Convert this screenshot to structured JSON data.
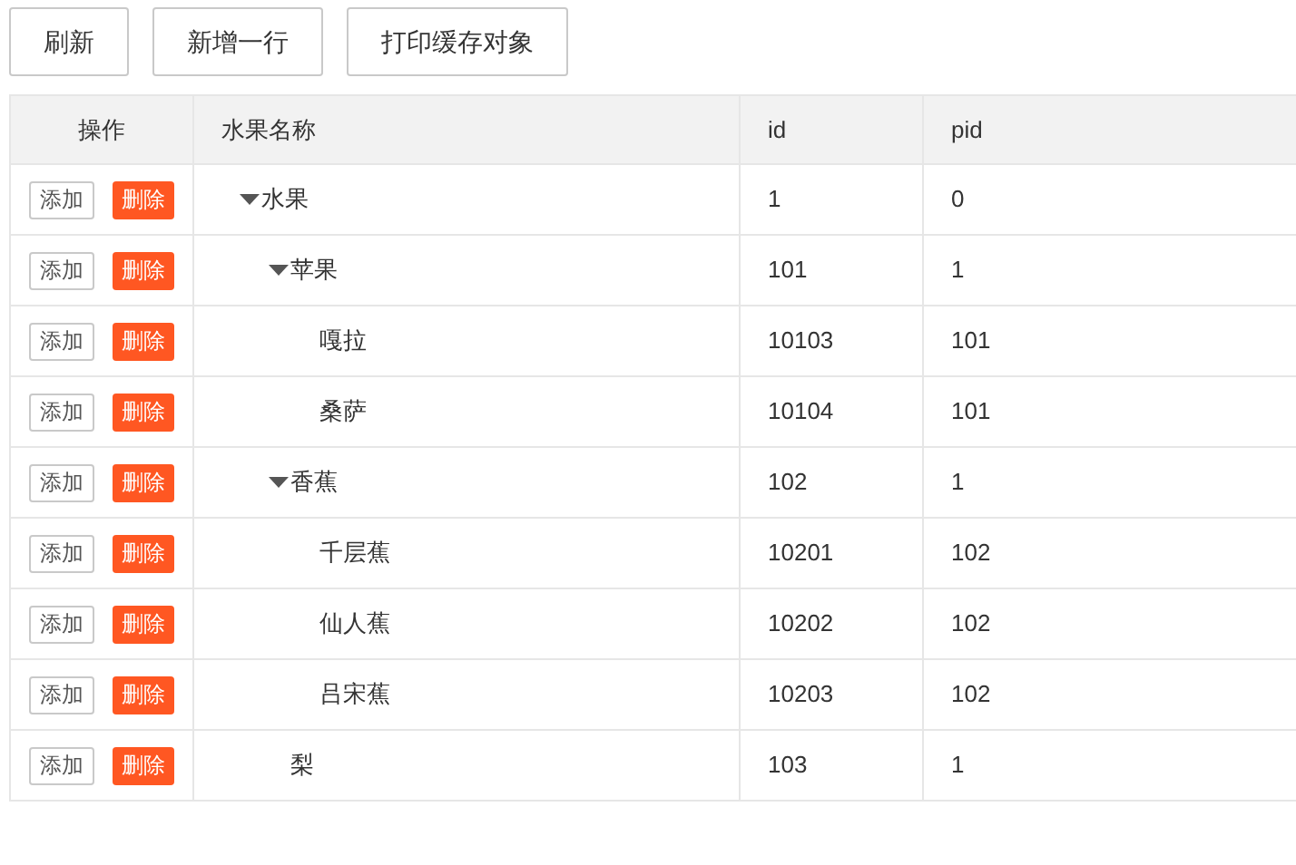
{
  "toolbar": [
    "刷新",
    "新增一行",
    "打印缓存对象"
  ],
  "table": {
    "columns": [
      "操作",
      "水果名称",
      "id",
      "pid"
    ],
    "rows": [
      {
        "name": "水果",
        "id": "1",
        "pid": "0",
        "actions": [
          "添加",
          "删除"
        ],
        "expanded": true,
        "children": [
          {
            "name": "苹果",
            "id": "101",
            "pid": "1",
            "actions": [
              "添加",
              "删除"
            ],
            "expanded": true,
            "children": [
              {
                "name": "嘎拉",
                "id": "10103",
                "pid": "101",
                "actions": [
                  "添加",
                  "删除"
                ]
              },
              {
                "name": "桑萨",
                "id": "10104",
                "pid": "101",
                "actions": [
                  "添加",
                  "删除"
                ]
              }
            ]
          },
          {
            "name": "香蕉",
            "id": "102",
            "pid": "1",
            "actions": [
              "添加",
              "删除"
            ],
            "expanded": true,
            "children": [
              {
                "name": "千层蕉",
                "id": "10201",
                "pid": "102",
                "actions": [
                  "添加",
                  "删除"
                ]
              },
              {
                "name": "仙人蕉",
                "id": "10202",
                "pid": "102",
                "actions": [
                  "添加",
                  "删除"
                ]
              },
              {
                "name": "吕宋蕉",
                "id": "10203",
                "pid": "102",
                "actions": [
                  "添加",
                  "删除"
                ]
              }
            ]
          },
          {
            "name": "梨",
            "id": "103",
            "pid": "1",
            "actions": [
              "添加",
              "删除"
            ]
          }
        ]
      }
    ]
  }
}
